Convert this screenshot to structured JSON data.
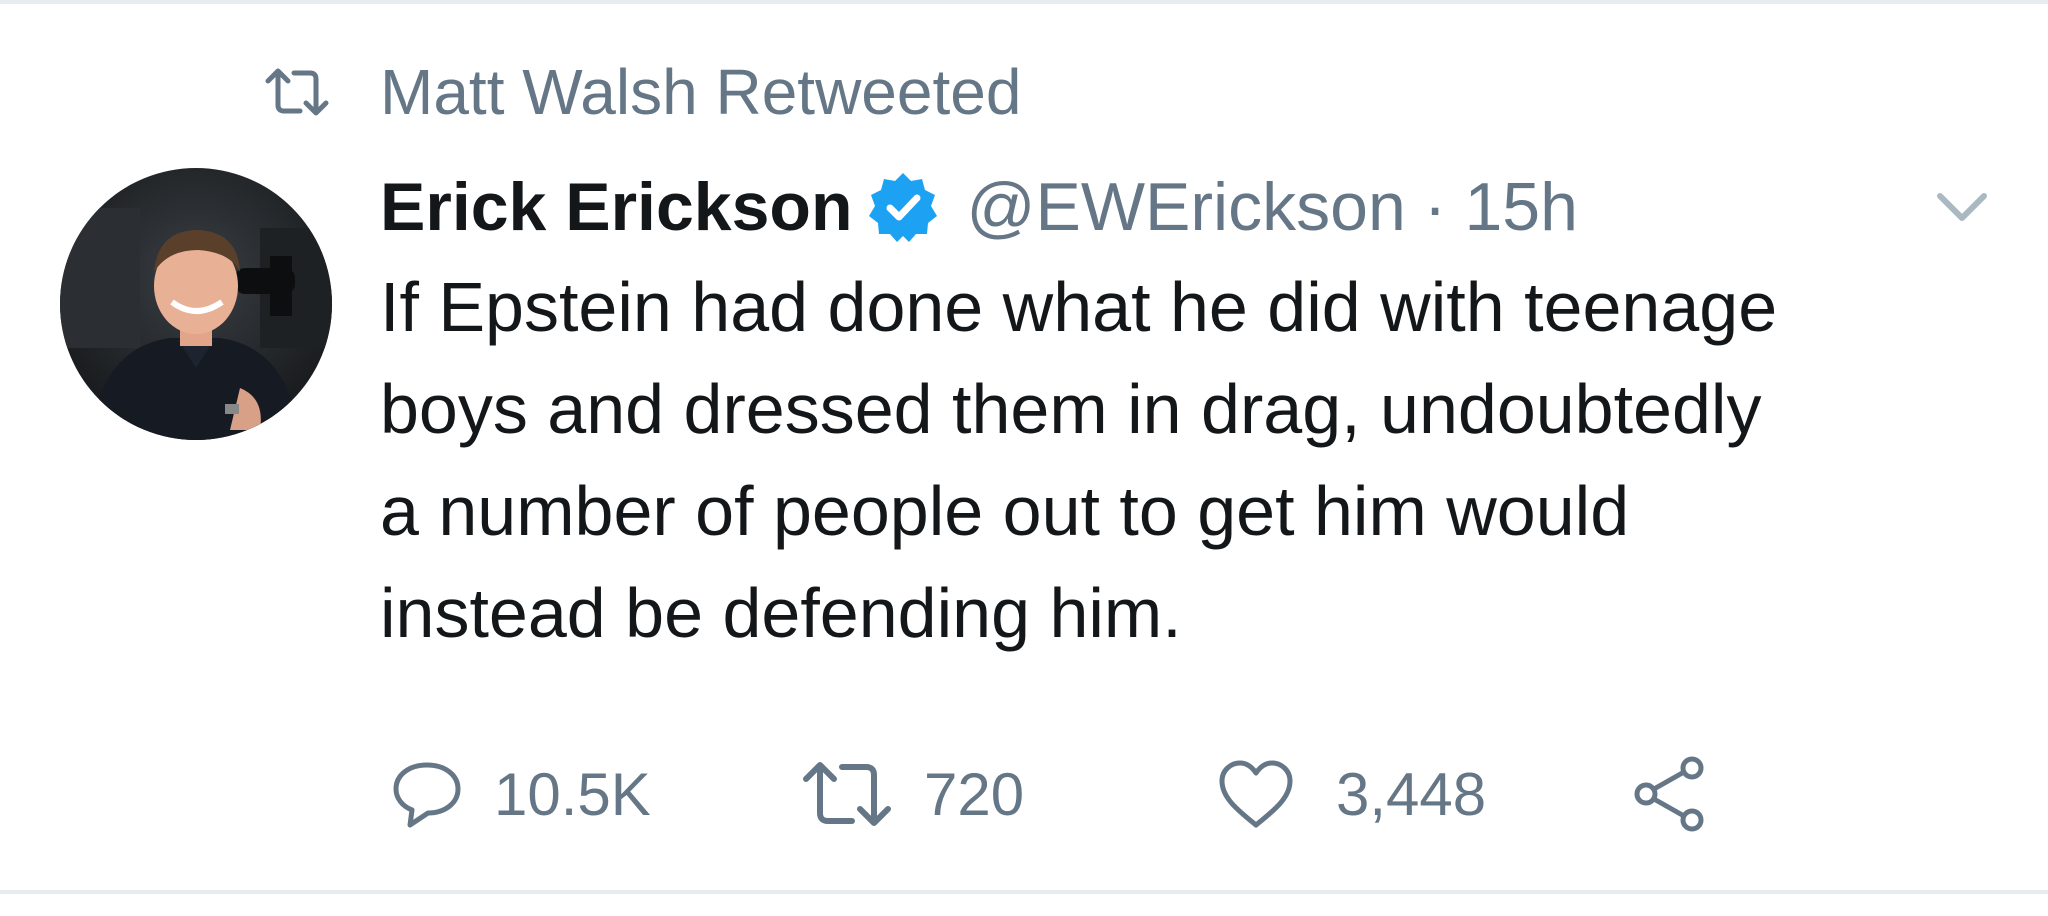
{
  "social_context": {
    "icon": "retweet-icon",
    "text": "Matt Walsh Retweeted"
  },
  "tweet": {
    "author": {
      "display_name": "Erick Erickson",
      "verified": true,
      "handle": "@EWErickson",
      "separator": "·",
      "time": "15h"
    },
    "text_lines": [
      "If Epstein had done what he did with teenage",
      "boys and dressed them in drag, undoubtedly",
      "a number of people out to get him would",
      "instead be defending him."
    ],
    "actions": {
      "reply_count": "10.5K",
      "retweet_count": "720",
      "like_count": "3,448"
    }
  },
  "colors": {
    "text_primary": "#14171a",
    "text_secondary": "#657786",
    "verified_blue": "#1da1f2",
    "border": "#e6ecf0"
  }
}
